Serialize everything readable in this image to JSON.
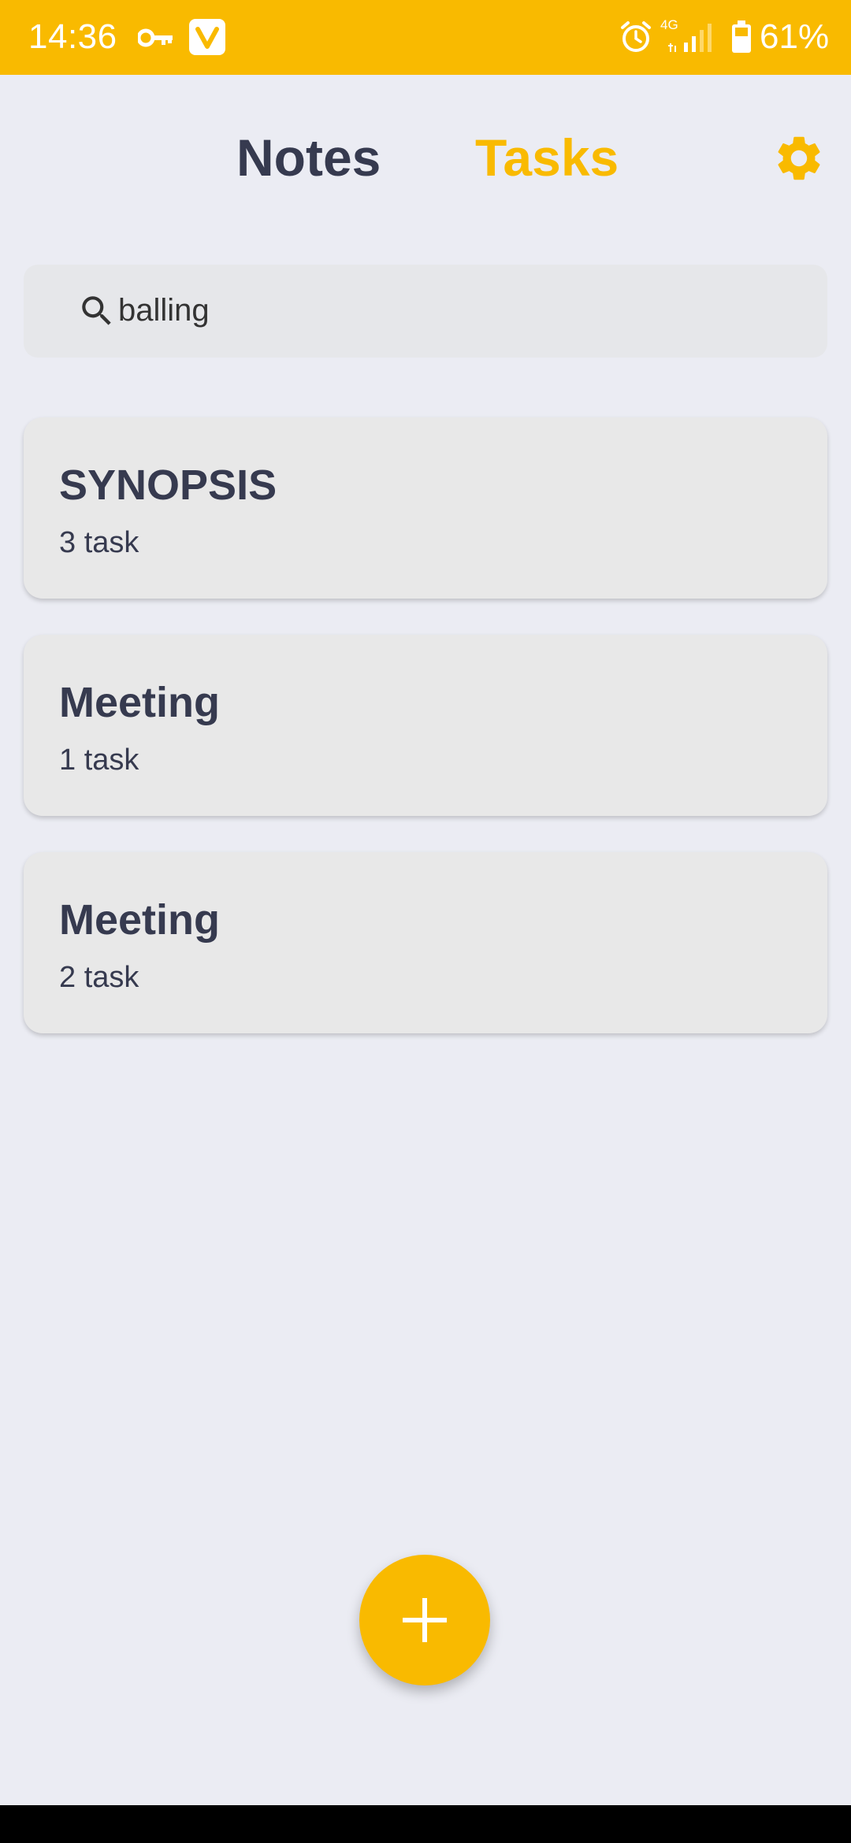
{
  "status_bar": {
    "time": "14:36",
    "network": "4G",
    "battery": "61%",
    "icons": [
      "key-icon",
      "v-app-icon",
      "alarm-icon",
      "signal-icon",
      "battery-icon"
    ]
  },
  "header": {
    "tabs": [
      {
        "label": "Notes",
        "active": false
      },
      {
        "label": "Tasks",
        "active": true
      }
    ],
    "settings_icon": "gear-icon"
  },
  "search": {
    "value": "balling",
    "icon": "search-icon"
  },
  "task_lists": [
    {
      "title": "SYNOPSIS",
      "count": "3 task"
    },
    {
      "title": "Meeting",
      "count": "1 task"
    },
    {
      "title": "Meeting",
      "count": "2 task"
    }
  ],
  "fab": {
    "icon": "plus-icon"
  },
  "colors": {
    "accent": "#f9ba00",
    "background": "#ebecf3",
    "card": "#e8e8e8",
    "text_dark": "#363a4f"
  }
}
